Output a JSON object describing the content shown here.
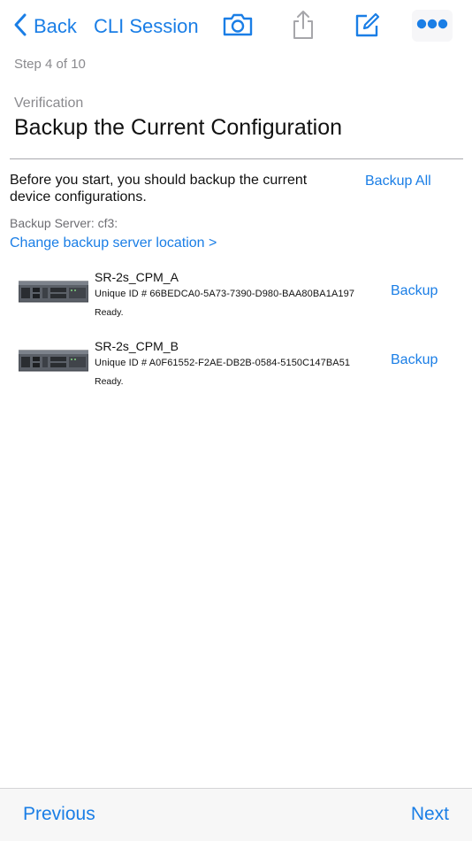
{
  "navbar": {
    "back_label": "Back",
    "title": "CLI Session",
    "icons": [
      "chevron-left-icon",
      "camera-icon",
      "share-icon",
      "compose-icon",
      "more-icon"
    ]
  },
  "step_text": "Step 4 of 10",
  "section_label": "Verification",
  "page_title": "Backup the Current Configuration",
  "intro_text": "Before you start, you should backup the current device configurations.",
  "backup_all_label": "Backup All",
  "backup_server_label": "Backup Server: cf3:",
  "change_location_link": "Change backup server location >",
  "devices": [
    {
      "name": "SR-2s_CPM_A",
      "unique_id": "Unique ID # 66BEDCA0-5A73-7390-D980-BAA80BA1A197",
      "status": "Ready.",
      "backup_label": "Backup"
    },
    {
      "name": "SR-2s_CPM_B",
      "unique_id": "Unique ID # A0F61552-F2AE-DB2B-0584-5150C147BA51",
      "status": "Ready.",
      "backup_label": "Backup"
    }
  ],
  "toolbar": {
    "previous_label": "Previous",
    "next_label": "Next"
  },
  "colors": {
    "accent": "#1a7ee6",
    "secondary_text": "#8a8a8e",
    "divider": "#a9a9ae",
    "toolbar_bg": "#f7f7f7"
  }
}
